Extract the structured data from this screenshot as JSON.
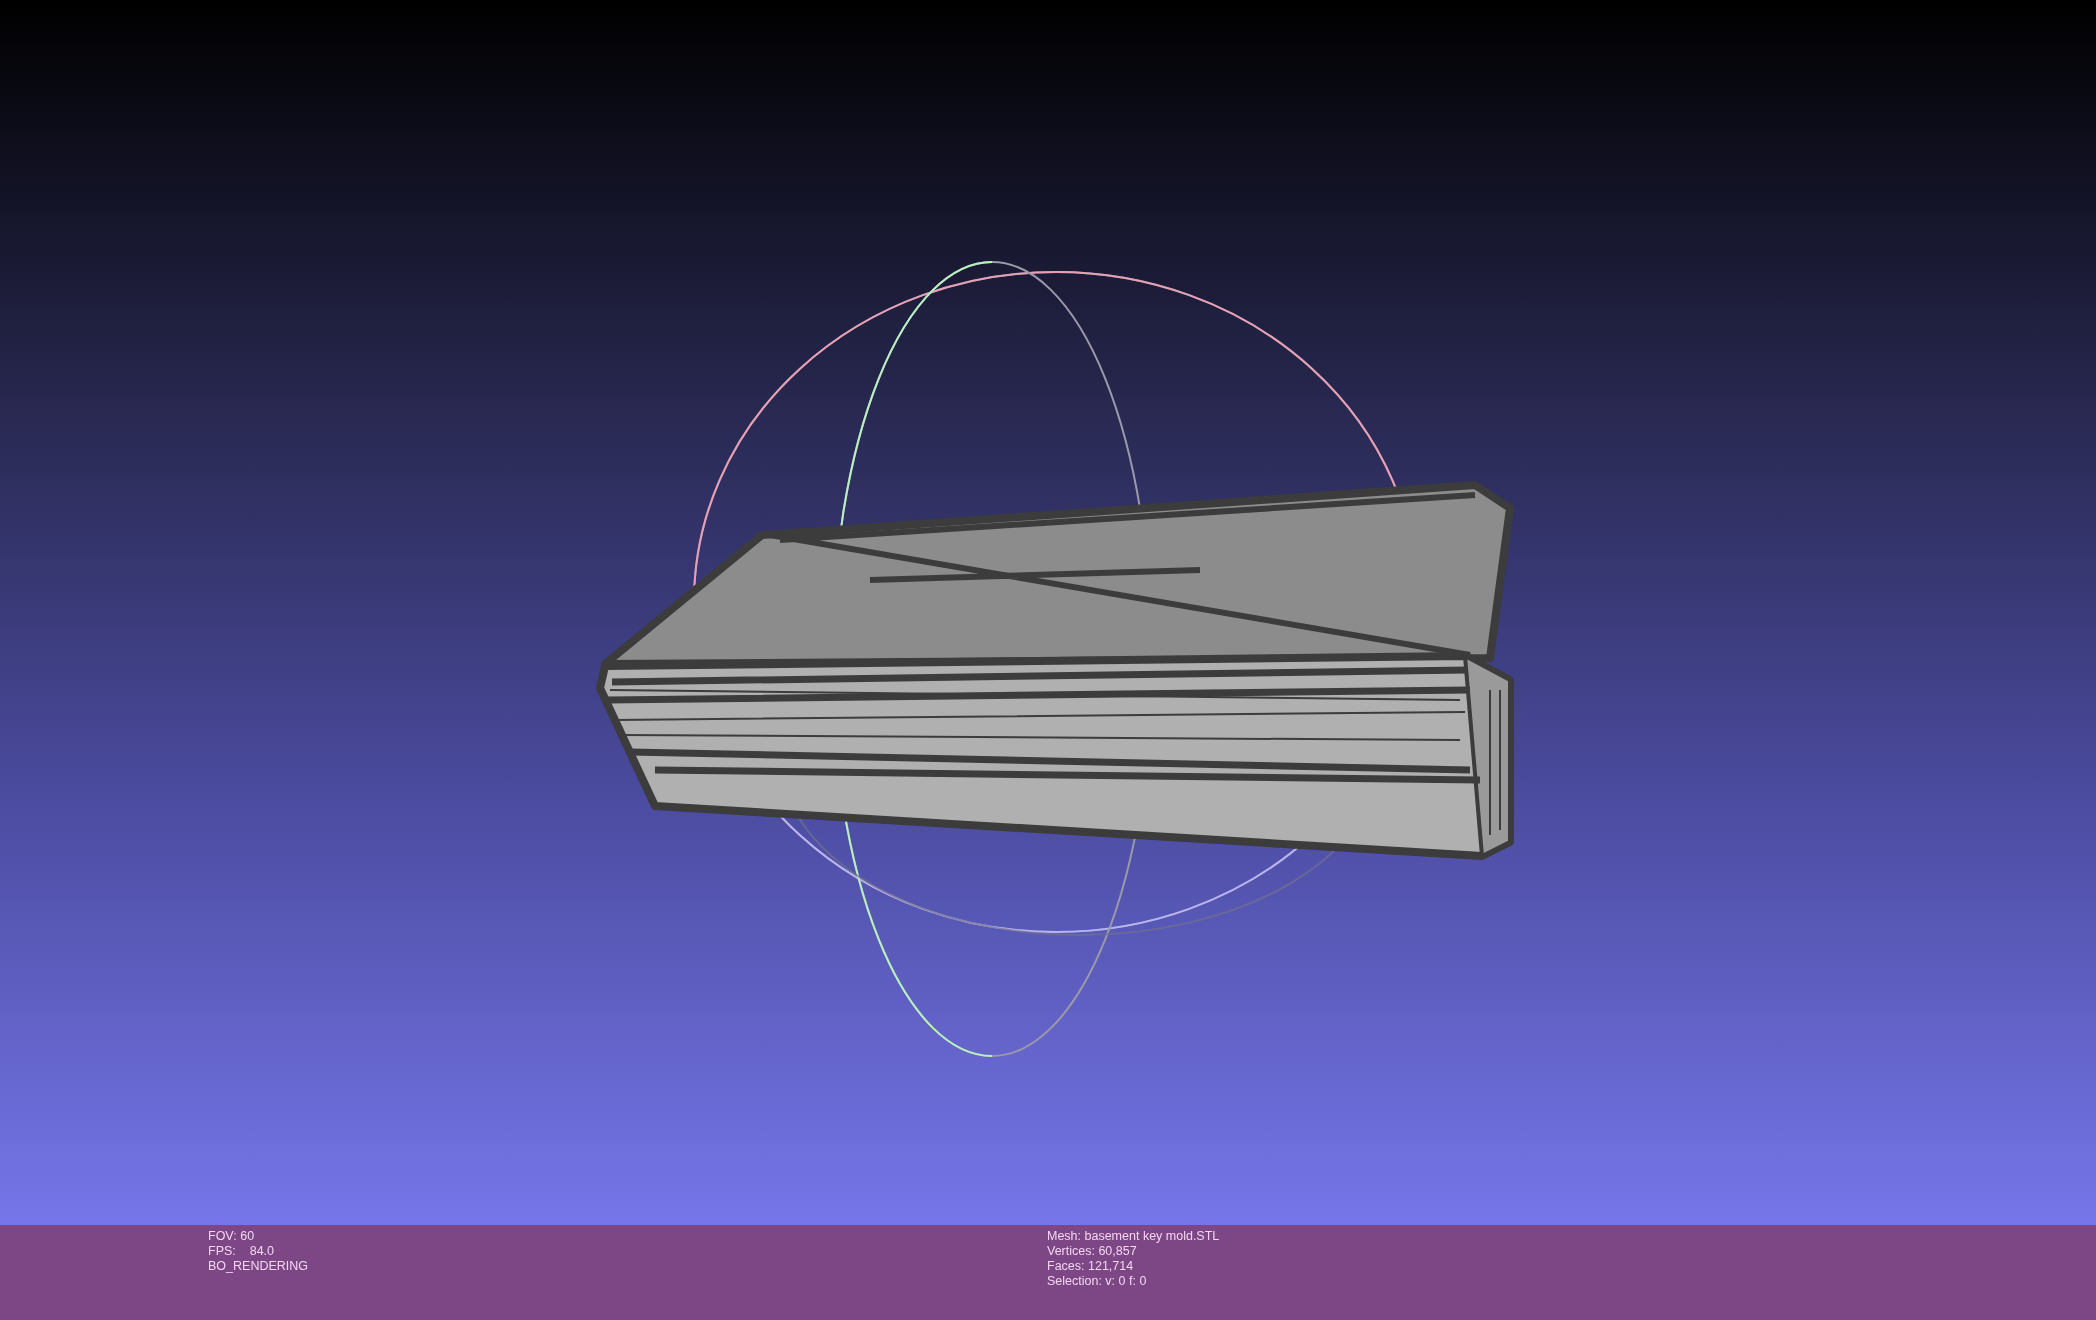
{
  "viewport": {
    "kind": "scene"
  },
  "status_left": [
    "FOV: 60",
    "FPS:    84.0",
    "BO_RENDERING"
  ],
  "status_right": [
    "Mesh: basement key mold.STL",
    "Vertices: 60,857",
    "Faces: 121,714",
    "Selection: v: 0 f: 0"
  ]
}
